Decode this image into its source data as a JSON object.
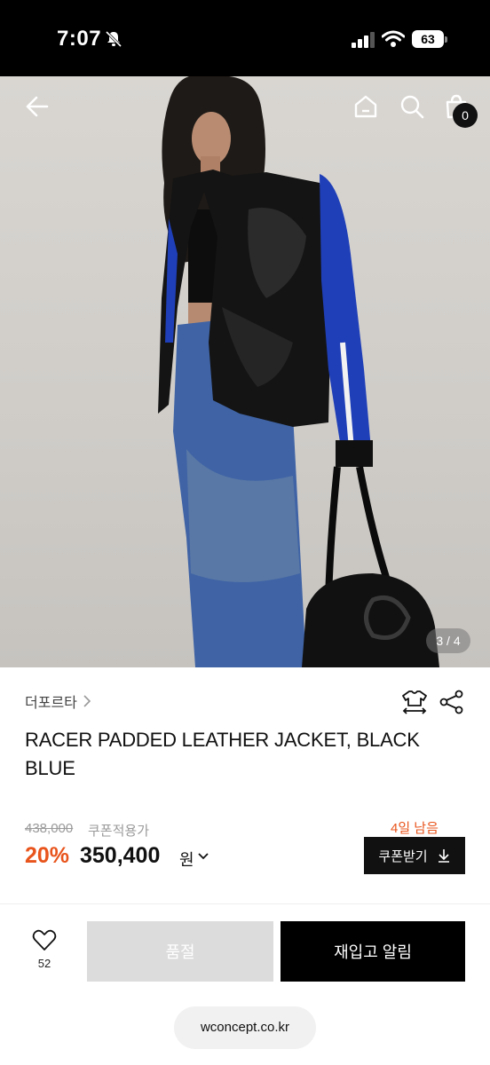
{
  "status_bar": {
    "time": "7:07",
    "battery": "63"
  },
  "gallery": {
    "page_indicator": "3 / 4",
    "cart_count": "0",
    "icons": [
      "back-arrow-icon",
      "home-icon",
      "search-icon",
      "shopping-bag-icon"
    ]
  },
  "product": {
    "brand": "더포르타",
    "title": "RACER PADDED LEATHER JACKET, BLACK BLUE"
  },
  "pricing": {
    "original_price": "438,000",
    "coupon_note": "쿠폰적용가",
    "discount": "20%",
    "sale_price": "350,400",
    "currency": "원",
    "days_left": "4일 남음",
    "coupon_button": "쿠폰받기"
  },
  "actions": {
    "wish_count": "52",
    "sold_out": "품절",
    "restock_alert": "재입고 알림"
  },
  "browser": {
    "url": "wconcept.co.kr"
  },
  "colors": {
    "accent": "#e8541c",
    "primary": "#000000",
    "disabled": "#dcdcdc"
  }
}
